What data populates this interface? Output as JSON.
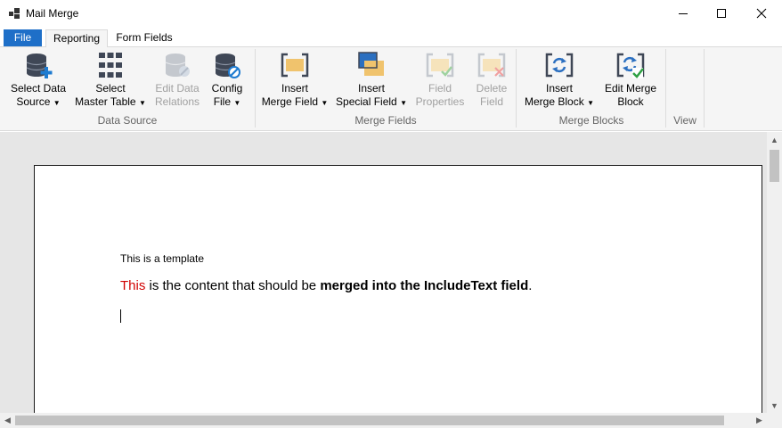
{
  "window": {
    "title": "Mail Merge"
  },
  "menu_tabs": {
    "file": "File",
    "reporting": "Reporting",
    "form_fields": "Form Fields"
  },
  "ribbon": {
    "data_source": {
      "label": "Data Source",
      "select_data_source": {
        "line1": "Select Data",
        "line2": "Source"
      },
      "select_master_table": {
        "line1": "Select",
        "line2": "Master Table"
      },
      "edit_data_relations": {
        "line1": "Edit Data",
        "line2": "Relations"
      },
      "config_file": {
        "line1": "Config",
        "line2": "File"
      }
    },
    "merge_fields": {
      "label": "Merge Fields",
      "insert_merge_field": {
        "line1": "Insert",
        "line2": "Merge Field"
      },
      "insert_special_field": {
        "line1": "Insert",
        "line2": "Special Field"
      },
      "field_properties": {
        "line1": "Field",
        "line2": "Properties"
      },
      "delete_field": {
        "line1": "Delete",
        "line2": "Field"
      }
    },
    "merge_blocks": {
      "label": "Merge Blocks",
      "insert_merge_block": {
        "line1": "Insert",
        "line2": "Merge Block"
      },
      "edit_merge_block": {
        "line1": "Edit Merge",
        "line2": "Block"
      }
    },
    "view": {
      "label": "View"
    }
  },
  "document": {
    "line1": "This is a template",
    "line2": {
      "red": "This",
      "normal": " is the content that should be ",
      "bold": "merged into the IncludeText field",
      "end": "."
    }
  }
}
